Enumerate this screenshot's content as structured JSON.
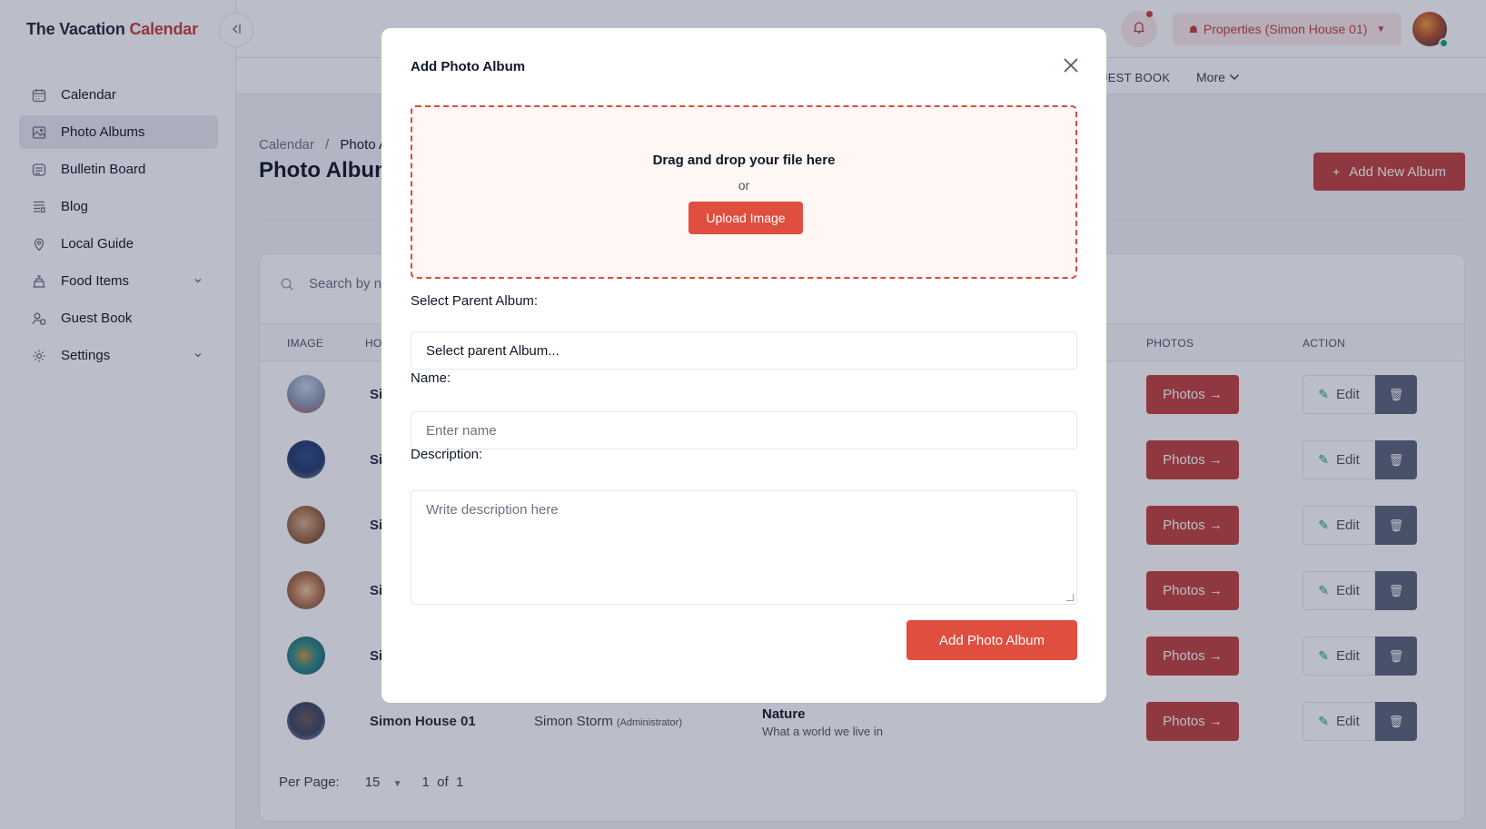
{
  "app": {
    "brand_primary": "The Vacation",
    "brand_accent": "Calendar",
    "accent_color": "#c2413b"
  },
  "sidebar": {
    "items": [
      {
        "label": "Calendar",
        "icon": "calendar-icon"
      },
      {
        "label": "Photo Albums",
        "icon": "image-icon",
        "active": true
      },
      {
        "label": "Bulletin Board",
        "icon": "board-icon"
      },
      {
        "label": "Blog",
        "icon": "blog-icon"
      },
      {
        "label": "Local Guide",
        "icon": "map-pin-icon"
      },
      {
        "label": "Food Items",
        "icon": "food-icon",
        "expandable": true
      },
      {
        "label": "Guest Book",
        "icon": "guest-icon"
      },
      {
        "label": "Settings",
        "icon": "gear-icon",
        "expandable": true
      }
    ]
  },
  "header": {
    "property_selector": "Properties (Simon House 01)",
    "subnav_guest": "UEST BOOK",
    "subnav_more": "More"
  },
  "page": {
    "breadcrumb_root": "Calendar",
    "breadcrumb_sep": "/",
    "breadcrumb_current": "Photo A",
    "title": "Photo Albun",
    "add_button": "Add New Album"
  },
  "table": {
    "search_placeholder": "Search by n",
    "columns": {
      "image": "IMAGE",
      "home": "HO",
      "photos": "PHOTOS",
      "action": "ACTION"
    },
    "rows": [
      {
        "home": "Si",
        "photos": "Photos →",
        "edit": "Edit"
      },
      {
        "home": "Si",
        "photos": "Photos →",
        "edit": "Edit"
      },
      {
        "home": "Si",
        "photos": "Photos →",
        "edit": "Edit"
      },
      {
        "home": "Si",
        "photos": "Photos →",
        "edit": "Edit"
      },
      {
        "home": "Si",
        "photos": "Photos →",
        "edit": "Edit"
      },
      {
        "home": "Simon House 01",
        "owner": "Simon Storm",
        "owner_role": "(Administrator)",
        "desc_title": "Nature",
        "desc_sub": "What a world we live in",
        "photos": "Photos →",
        "edit": "Edit"
      }
    ],
    "pager": {
      "per_page_label": "Per Page:",
      "per_page_value": "15",
      "page_text": "1  of  1"
    }
  },
  "modal": {
    "title": "Add Photo Album",
    "dropzone_title": "Drag and drop your file here",
    "dropzone_or": "or",
    "upload_button": "Upload Image",
    "parent_label": "Select Parent Album:",
    "parent_value": "Select parent Album...",
    "name_label": "Name:",
    "name_placeholder": "Enter name",
    "description_label": "Description:",
    "description_placeholder": "Write description here",
    "submit": "Add Photo Album"
  }
}
